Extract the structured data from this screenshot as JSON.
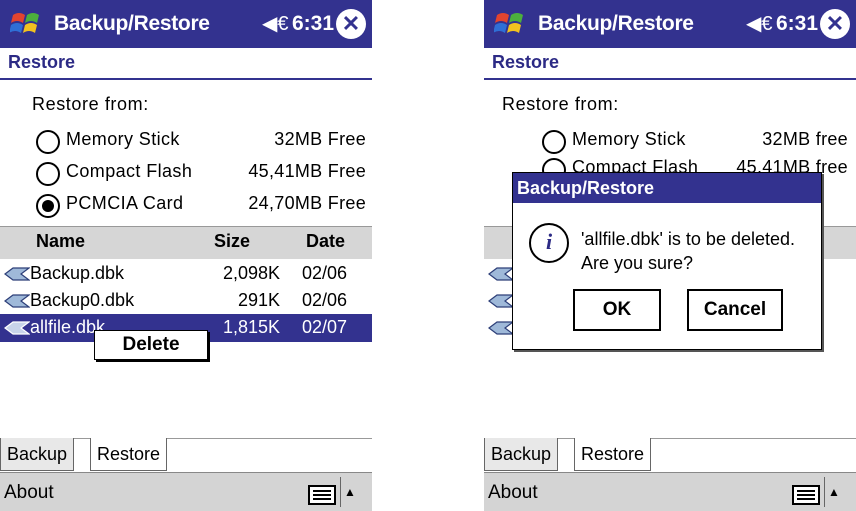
{
  "screen1": {
    "title": "Backup/Restore",
    "speaker_glyph": "◀€",
    "time": "6:31",
    "close_glyph": "✕",
    "subheader": "Restore",
    "restore_from_label": "Restore from:",
    "options": [
      {
        "label": "Memory Stick",
        "free": "32MB Free",
        "selected": false
      },
      {
        "label": "Compact Flash",
        "free": "45,41MB Free",
        "selected": false
      },
      {
        "label": "PCMCIA Card",
        "free": "24,70MB Free",
        "selected": true
      }
    ],
    "columns": {
      "name": "Name",
      "size": "Size",
      "date": "Date"
    },
    "files": [
      {
        "name": "Backup.dbk",
        "size": "2,098K",
        "date": "02/06",
        "selected": false
      },
      {
        "name": "Backup0.dbk",
        "size": "291K",
        "date": "02/06",
        "selected": false
      },
      {
        "name": "allfile.dbk",
        "size": "1,815K",
        "date": "02/07",
        "selected": true
      }
    ],
    "context_menu": "Delete",
    "tabs": [
      "Backup",
      "Restore"
    ],
    "menu_left": "About",
    "up_arrow": "▲"
  },
  "screen2": {
    "title": "Backup/Restore",
    "speaker_glyph": "◀€",
    "time": "6:31",
    "close_glyph": "✕",
    "subheader": "Restore",
    "restore_from_label": "Restore from:",
    "options": [
      {
        "label": "Memory Stick",
        "free": "32MB free"
      },
      {
        "label": "Compact Flash",
        "free": "45,41MB free"
      }
    ],
    "dialog": {
      "title": "Backup/Restore",
      "icon_glyph": "i",
      "line1": "'allfile.dbk' is to be deleted.",
      "line2": "Are you sure?",
      "ok": "OK",
      "cancel": "Cancel"
    },
    "tabs": [
      "Backup",
      "Restore"
    ],
    "menu_left": "About",
    "up_arrow": "▲"
  },
  "colors": {
    "titlebar": "#33328f",
    "selection": "#33328f",
    "header_bg": "#d6d6d6",
    "menubar_bg": "#d4d4d4"
  },
  "icons": [
    "windows-start-icon",
    "speaker-icon",
    "close-icon",
    "radio-icon",
    "file-icon",
    "keyboard-icon",
    "info-icon",
    "up-arrow-icon"
  ]
}
